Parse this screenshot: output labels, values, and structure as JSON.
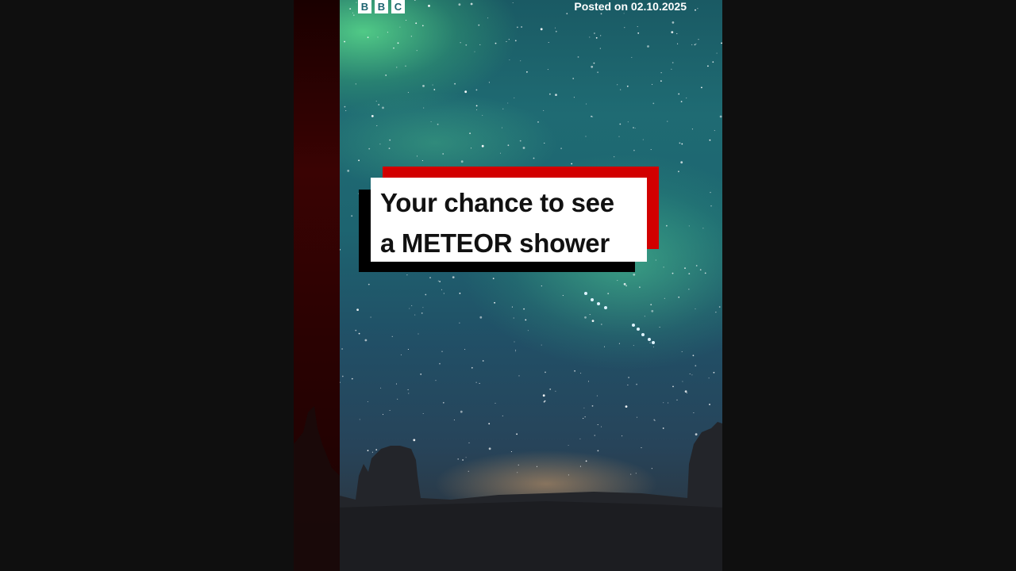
{
  "video": {
    "brand_letters": [
      "B",
      "B",
      "C"
    ],
    "posted_label": "Posted on 02.10.2025",
    "headline_line1": "Your chance to see",
    "headline_line2": "a METEOR shower"
  },
  "colors": {
    "page_background": "#0f0f0f",
    "headline_card": "#ffffff",
    "headline_accent_red": "#d20000",
    "headline_accent_black": "#000000"
  }
}
